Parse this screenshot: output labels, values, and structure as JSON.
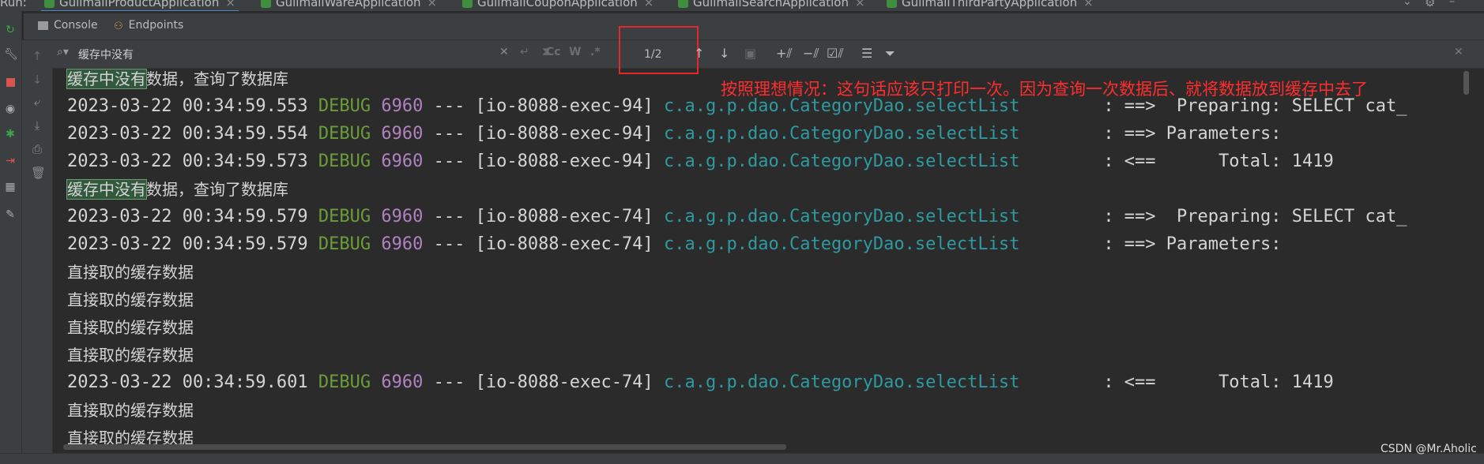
{
  "run_bar": {
    "label": "Run:",
    "tabs": [
      {
        "label": "GulimallProductApplication",
        "active": true
      },
      {
        "label": "GulimallWareApplication"
      },
      {
        "label": "GulimallCouponApplication"
      },
      {
        "label": "GulimallSearchApplication"
      },
      {
        "label": "GulimallThirdPartyApplication"
      }
    ]
  },
  "subtabs": {
    "console": "Console",
    "endpoints": "Endpoints"
  },
  "search": {
    "query": "缓存中没有",
    "match_case": "Cc",
    "words": "W",
    "regex": ".*",
    "match_count": "1/2"
  },
  "annotation": "按照理想情况：这句话应该只打印一次。因为查询一次数据后、就将数据放到缓存中去了",
  "log_lines": [
    {
      "type": "text",
      "hl": "缓存中没有",
      "rest": "数据，查询了数据库"
    },
    {
      "type": "log",
      "ts": "2023-03-22 00:34:59.553",
      "level": "DEBUG",
      "pid": "6960",
      "sep": " --- ",
      "thread": "[io-8088-exec-94]",
      "logger": "c.a.g.p.dao.CategoryDao.selectList",
      "msg": "        : ==>  Preparing: SELECT cat_"
    },
    {
      "type": "log",
      "ts": "2023-03-22 00:34:59.554",
      "level": "DEBUG",
      "pid": "6960",
      "sep": " --- ",
      "thread": "[io-8088-exec-94]",
      "logger": "c.a.g.p.dao.CategoryDao.selectList",
      "msg": "        : ==> Parameters:"
    },
    {
      "type": "log",
      "ts": "2023-03-22 00:34:59.573",
      "level": "DEBUG",
      "pid": "6960",
      "sep": " --- ",
      "thread": "[io-8088-exec-94]",
      "logger": "c.a.g.p.dao.CategoryDao.selectList",
      "msg": "        : <==      Total: 1419"
    },
    {
      "type": "text",
      "hl": "缓存中没有",
      "rest": "数据，查询了数据库"
    },
    {
      "type": "log",
      "ts": "2023-03-22 00:34:59.579",
      "level": "DEBUG",
      "pid": "6960",
      "sep": " --- ",
      "thread": "[io-8088-exec-74]",
      "logger": "c.a.g.p.dao.CategoryDao.selectList",
      "msg": "        : ==>  Preparing: SELECT cat_"
    },
    {
      "type": "log",
      "ts": "2023-03-22 00:34:59.579",
      "level": "DEBUG",
      "pid": "6960",
      "sep": " --- ",
      "thread": "[io-8088-exec-74]",
      "logger": "c.a.g.p.dao.CategoryDao.selectList",
      "msg": "        : ==> Parameters:"
    },
    {
      "type": "text",
      "hl": "",
      "rest": "直接取的缓存数据"
    },
    {
      "type": "text",
      "hl": "",
      "rest": "直接取的缓存数据"
    },
    {
      "type": "text",
      "hl": "",
      "rest": "直接取的缓存数据"
    },
    {
      "type": "text",
      "hl": "",
      "rest": "直接取的缓存数据"
    },
    {
      "type": "log",
      "ts": "2023-03-22 00:34:59.601",
      "level": "DEBUG",
      "pid": "6960",
      "sep": " --- ",
      "thread": "[io-8088-exec-74]",
      "logger": "c.a.g.p.dao.CategoryDao.selectList",
      "msg": "        : <==      Total: 1419"
    },
    {
      "type": "text",
      "hl": "",
      "rest": "直接取的缓存数据"
    },
    {
      "type": "text",
      "hl": "",
      "rest": "直接取的缓存数据"
    }
  ],
  "watermark": "CSDN @Mr.Aholic",
  "colors": {
    "highlight_box": "#e5262b",
    "annotation": "#ff2d2d",
    "debug": "#6a9d3a",
    "pid": "#b182c1",
    "logger": "#2e9aa0"
  }
}
